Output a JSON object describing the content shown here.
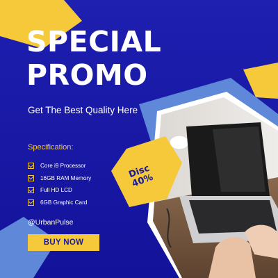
{
  "promo": {
    "title_line_1": "SPECIAL",
    "title_line_2": "PROMO",
    "subtitle": "Get The Best Quality Here",
    "spec_heading": "Specification:",
    "specs": [
      "Core i9 Processor",
      "16GB RAM Memory",
      "Full HD LCD",
      "6GB Graphic Card"
    ],
    "handle": "@UrbanPulse",
    "cta_label": "BUY NOW",
    "badge_line_1": "Disc",
    "badge_line_2": "40%"
  },
  "colors": {
    "background": "#1717a8",
    "accent_yellow": "#f5c93a",
    "accent_light_blue": "#5f88d8",
    "text_white": "#ffffff"
  }
}
